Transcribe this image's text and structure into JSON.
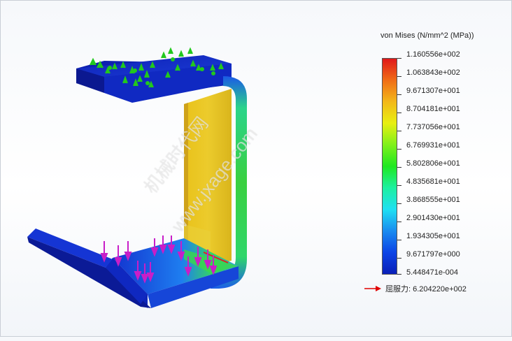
{
  "legend": {
    "title": "von Mises (N/mm^2 (MPa))",
    "ticks": [
      "1.160556e+002",
      "1.063843e+002",
      "9.671307e+001",
      "8.704181e+001",
      "7.737056e+001",
      "6.769931e+001",
      "5.802806e+001",
      "4.835681e+001",
      "3.868555e+001",
      "2.901430e+001",
      "1.934305e+001",
      "9.671797e+000",
      "5.448471e-004"
    ],
    "yield_label": "屈服力: 6.204220e+002",
    "yield_arrow_color": "#e00000"
  },
  "watermark": {
    "cn": "机械时代网",
    "url": "www.jxage.com"
  },
  "colors": {
    "fixture_marker": "#22c81e",
    "load_arrow": "#c81ec8"
  },
  "model": {
    "icons": [
      "fixed-geometry-icon",
      "external-load-arrow-icon"
    ]
  }
}
